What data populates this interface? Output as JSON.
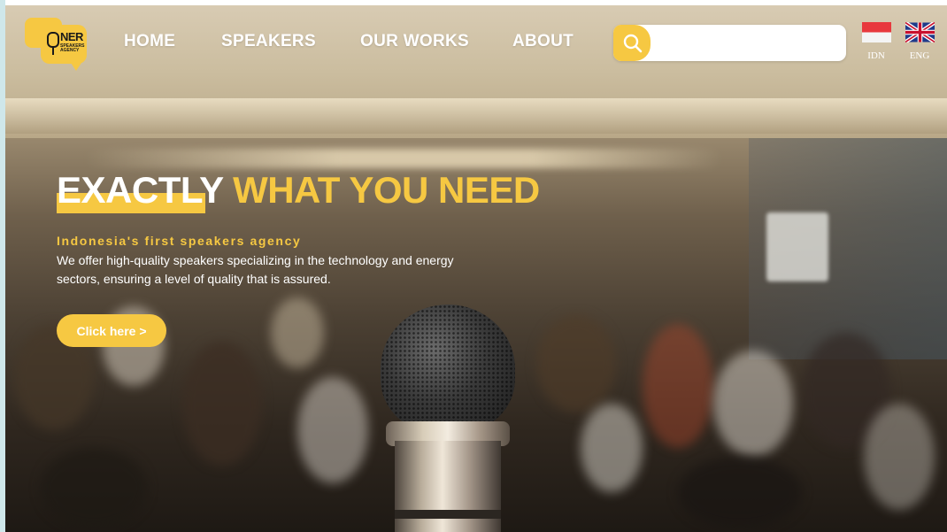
{
  "brand": {
    "logo_text": "NER",
    "logo_sub": "SPEAKERS AGENCY",
    "accent_color": "#f6c842"
  },
  "nav": {
    "items": [
      {
        "label": "HOME"
      },
      {
        "label": "SPEAKERS"
      },
      {
        "label": "OUR WORKS"
      },
      {
        "label": "ABOUT"
      }
    ]
  },
  "search": {
    "icon": "search-icon",
    "value": "",
    "placeholder": ""
  },
  "languages": [
    {
      "code": "IDN",
      "icon": "indonesia-flag-icon"
    },
    {
      "code": "ENG",
      "icon": "uk-flag-icon"
    }
  ],
  "hero": {
    "title_part1": "EXACTLY",
    "title_part2": " WHAT YOU NEED",
    "tagline": "Indonesia's first speakers agency",
    "description": "We offer high-quality speakers specializing in the technology and energy sectors, ensuring a level of quality that is assured.",
    "cta_label": "Click here >"
  }
}
